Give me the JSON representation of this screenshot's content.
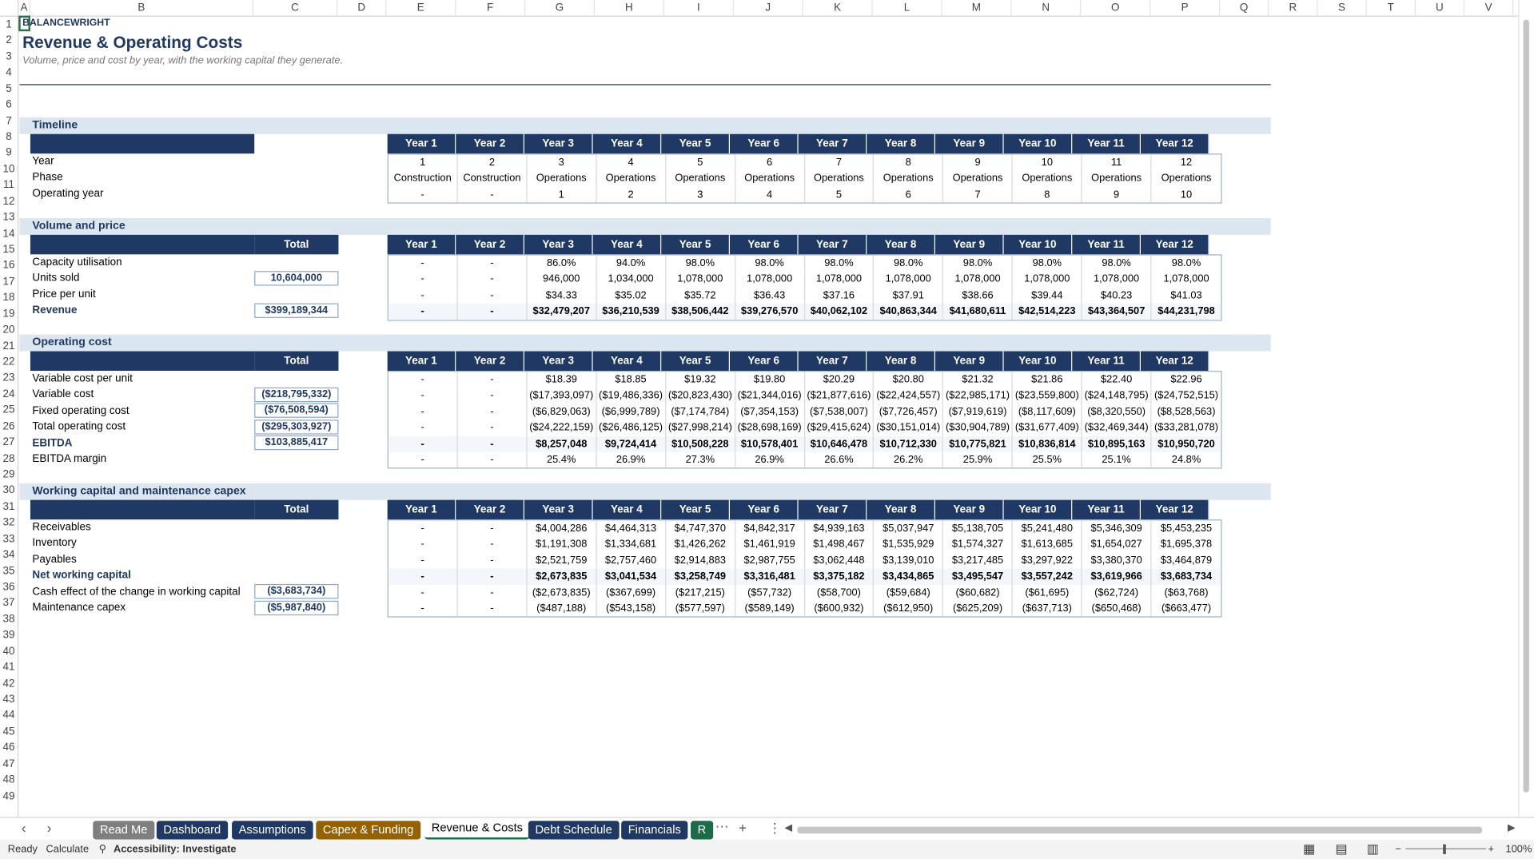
{
  "columns": [
    "A",
    "B",
    "C",
    "D",
    "E",
    "F",
    "G",
    "H",
    "I",
    "J",
    "K",
    "L",
    "M",
    "N",
    "O",
    "P",
    "Q",
    "R",
    "S",
    "T",
    "U",
    "V"
  ],
  "rows": [
    "1",
    "2",
    "3",
    "4",
    "5",
    "6",
    "7",
    "8",
    "9",
    "10",
    "11",
    "12",
    "13",
    "14",
    "15",
    "16",
    "17",
    "18",
    "19",
    "20",
    "21",
    "22",
    "23",
    "24",
    "25",
    "26",
    "27",
    "28",
    "29",
    "30",
    "31",
    "32",
    "33",
    "34",
    "35",
    "36",
    "37",
    "38",
    "39",
    "40",
    "41",
    "42",
    "43",
    "44",
    "45",
    "46",
    "47",
    "48",
    "49"
  ],
  "header": {
    "brand": "BALANCEWRIGHT",
    "title": "Revenue & Operating Costs",
    "subtitle": "Volume, price and cost by year, with the working capital they generate."
  },
  "years": [
    "Year 1",
    "Year 2",
    "Year 3",
    "Year 4",
    "Year 5",
    "Year 6",
    "Year 7",
    "Year 8",
    "Year 9",
    "Year 10",
    "Year 11",
    "Year 12"
  ],
  "total_label": "Total",
  "timeline": {
    "title": "Timeline",
    "rows": [
      {
        "label": "Year",
        "values": [
          "1",
          "2",
          "3",
          "4",
          "5",
          "6",
          "7",
          "8",
          "9",
          "10",
          "11",
          "12"
        ]
      },
      {
        "label": "Phase",
        "values": [
          "Construction",
          "Construction",
          "Operations",
          "Operations",
          "Operations",
          "Operations",
          "Operations",
          "Operations",
          "Operations",
          "Operations",
          "Operations",
          "Operations"
        ]
      },
      {
        "label": "Operating year",
        "values": [
          "-",
          "-",
          "1",
          "2",
          "3",
          "4",
          "5",
          "6",
          "7",
          "8",
          "9",
          "10"
        ]
      }
    ]
  },
  "volume": {
    "title": "Volume and price",
    "rows": [
      {
        "label": "Capacity utilisation",
        "total": "",
        "values": [
          "-",
          "-",
          "86.0%",
          "94.0%",
          "98.0%",
          "98.0%",
          "98.0%",
          "98.0%",
          "98.0%",
          "98.0%",
          "98.0%",
          "98.0%"
        ]
      },
      {
        "label": "Units sold",
        "total": "10,604,000",
        "values": [
          "-",
          "-",
          "946,000",
          "1,034,000",
          "1,078,000",
          "1,078,000",
          "1,078,000",
          "1,078,000",
          "1,078,000",
          "1,078,000",
          "1,078,000",
          "1,078,000"
        ]
      },
      {
        "label": "Price per unit",
        "total": "",
        "values": [
          "-",
          "-",
          "$34.33",
          "$35.02",
          "$35.72",
          "$36.43",
          "$37.16",
          "$37.91",
          "$38.66",
          "$39.44",
          "$40.23",
          "$41.03"
        ]
      },
      {
        "label": "Revenue",
        "total": "$399,189,344",
        "bold": true,
        "values": [
          "-",
          "-",
          "$32,479,207",
          "$36,210,539",
          "$38,506,442",
          "$39,276,570",
          "$40,062,102",
          "$40,863,344",
          "$41,680,611",
          "$42,514,223",
          "$43,364,507",
          "$44,231,798"
        ]
      }
    ]
  },
  "opcost": {
    "title": "Operating cost",
    "rows": [
      {
        "label": "Variable cost per unit",
        "total": "",
        "values": [
          "-",
          "-",
          "$18.39",
          "$18.85",
          "$19.32",
          "$19.80",
          "$20.29",
          "$20.80",
          "$21.32",
          "$21.86",
          "$22.40",
          "$22.96"
        ]
      },
      {
        "label": "Variable cost",
        "total": "($218,795,332)",
        "values": [
          "-",
          "-",
          "($17,393,097)",
          "($19,486,336)",
          "($20,823,430)",
          "($21,344,016)",
          "($21,877,616)",
          "($22,424,557)",
          "($22,985,171)",
          "($23,559,800)",
          "($24,148,795)",
          "($24,752,515)"
        ]
      },
      {
        "label": "Fixed operating cost",
        "total": "($76,508,594)",
        "values": [
          "-",
          "-",
          "($6,829,063)",
          "($6,999,789)",
          "($7,174,784)",
          "($7,354,153)",
          "($7,538,007)",
          "($7,726,457)",
          "($7,919,619)",
          "($8,117,609)",
          "($8,320,550)",
          "($8,528,563)"
        ]
      },
      {
        "label": "Total operating cost",
        "total": "($295,303,927)",
        "values": [
          "-",
          "-",
          "($24,222,159)",
          "($26,486,125)",
          "($27,998,214)",
          "($28,698,169)",
          "($29,415,624)",
          "($30,151,014)",
          "($30,904,789)",
          "($31,677,409)",
          "($32,469,344)",
          "($33,281,078)"
        ]
      },
      {
        "label": "EBITDA",
        "total": "$103,885,417",
        "bold": true,
        "values": [
          "-",
          "-",
          "$8,257,048",
          "$9,724,414",
          "$10,508,228",
          "$10,578,401",
          "$10,646,478",
          "$10,712,330",
          "$10,775,821",
          "$10,836,814",
          "$10,895,163",
          "$10,950,720"
        ]
      },
      {
        "label": "EBITDA margin",
        "total": "",
        "values": [
          "-",
          "-",
          "25.4%",
          "26.9%",
          "27.3%",
          "26.9%",
          "26.6%",
          "26.2%",
          "25.9%",
          "25.5%",
          "25.1%",
          "24.8%"
        ]
      }
    ]
  },
  "wc": {
    "title": "Working capital and maintenance capex",
    "rows": [
      {
        "label": "Receivables",
        "total": "",
        "values": [
          "-",
          "-",
          "$4,004,286",
          "$4,464,313",
          "$4,747,370",
          "$4,842,317",
          "$4,939,163",
          "$5,037,947",
          "$5,138,705",
          "$5,241,480",
          "$5,346,309",
          "$5,453,235"
        ]
      },
      {
        "label": "Inventory",
        "total": "",
        "values": [
          "-",
          "-",
          "$1,191,308",
          "$1,334,681",
          "$1,426,262",
          "$1,461,919",
          "$1,498,467",
          "$1,535,929",
          "$1,574,327",
          "$1,613,685",
          "$1,654,027",
          "$1,695,378"
        ]
      },
      {
        "label": "Payables",
        "total": "",
        "values": [
          "-",
          "-",
          "$2,521,759",
          "$2,757,460",
          "$2,914,883",
          "$2,987,755",
          "$3,062,448",
          "$3,139,010",
          "$3,217,485",
          "$3,297,922",
          "$3,380,370",
          "$3,464,879"
        ]
      },
      {
        "label": "Net working capital",
        "total": "",
        "bold": true,
        "values": [
          "-",
          "-",
          "$2,673,835",
          "$3,041,534",
          "$3,258,749",
          "$3,316,481",
          "$3,375,182",
          "$3,434,865",
          "$3,495,547",
          "$3,557,242",
          "$3,619,966",
          "$3,683,734"
        ]
      },
      {
        "label": "Cash effect of the change in working capital",
        "total": "($3,683,734)",
        "values": [
          "-",
          "-",
          "($2,673,835)",
          "($367,699)",
          "($217,215)",
          "($57,732)",
          "($58,700)",
          "($59,684)",
          "($60,682)",
          "($61,695)",
          "($62,724)",
          "($63,768)"
        ]
      },
      {
        "label": "Maintenance capex",
        "total": "($5,987,840)",
        "values": [
          "-",
          "-",
          "($487,188)",
          "($543,158)",
          "($577,597)",
          "($589,149)",
          "($600,932)",
          "($612,950)",
          "($625,209)",
          "($637,713)",
          "($650,468)",
          "($663,477)"
        ]
      }
    ]
  },
  "tabs": [
    {
      "label": "Read Me",
      "color": "#7f7f7f"
    },
    {
      "label": "Dashboard",
      "color": "#1f3864"
    },
    {
      "label": "Assumptions",
      "color": "#1f3864"
    },
    {
      "label": "Capex & Funding",
      "color": "#946200"
    },
    {
      "label": "Revenue & Costs",
      "color": "",
      "active": true
    },
    {
      "label": "Debt Schedule",
      "color": "#1f3864"
    },
    {
      "label": "Financials",
      "color": "#1f3864"
    },
    {
      "label": "R",
      "color": "#1e6b4a"
    }
  ],
  "status": {
    "ready": "Ready",
    "calculate": "Calculate",
    "accessibility": "Accessibility: Investigate",
    "zoom": "100%"
  }
}
